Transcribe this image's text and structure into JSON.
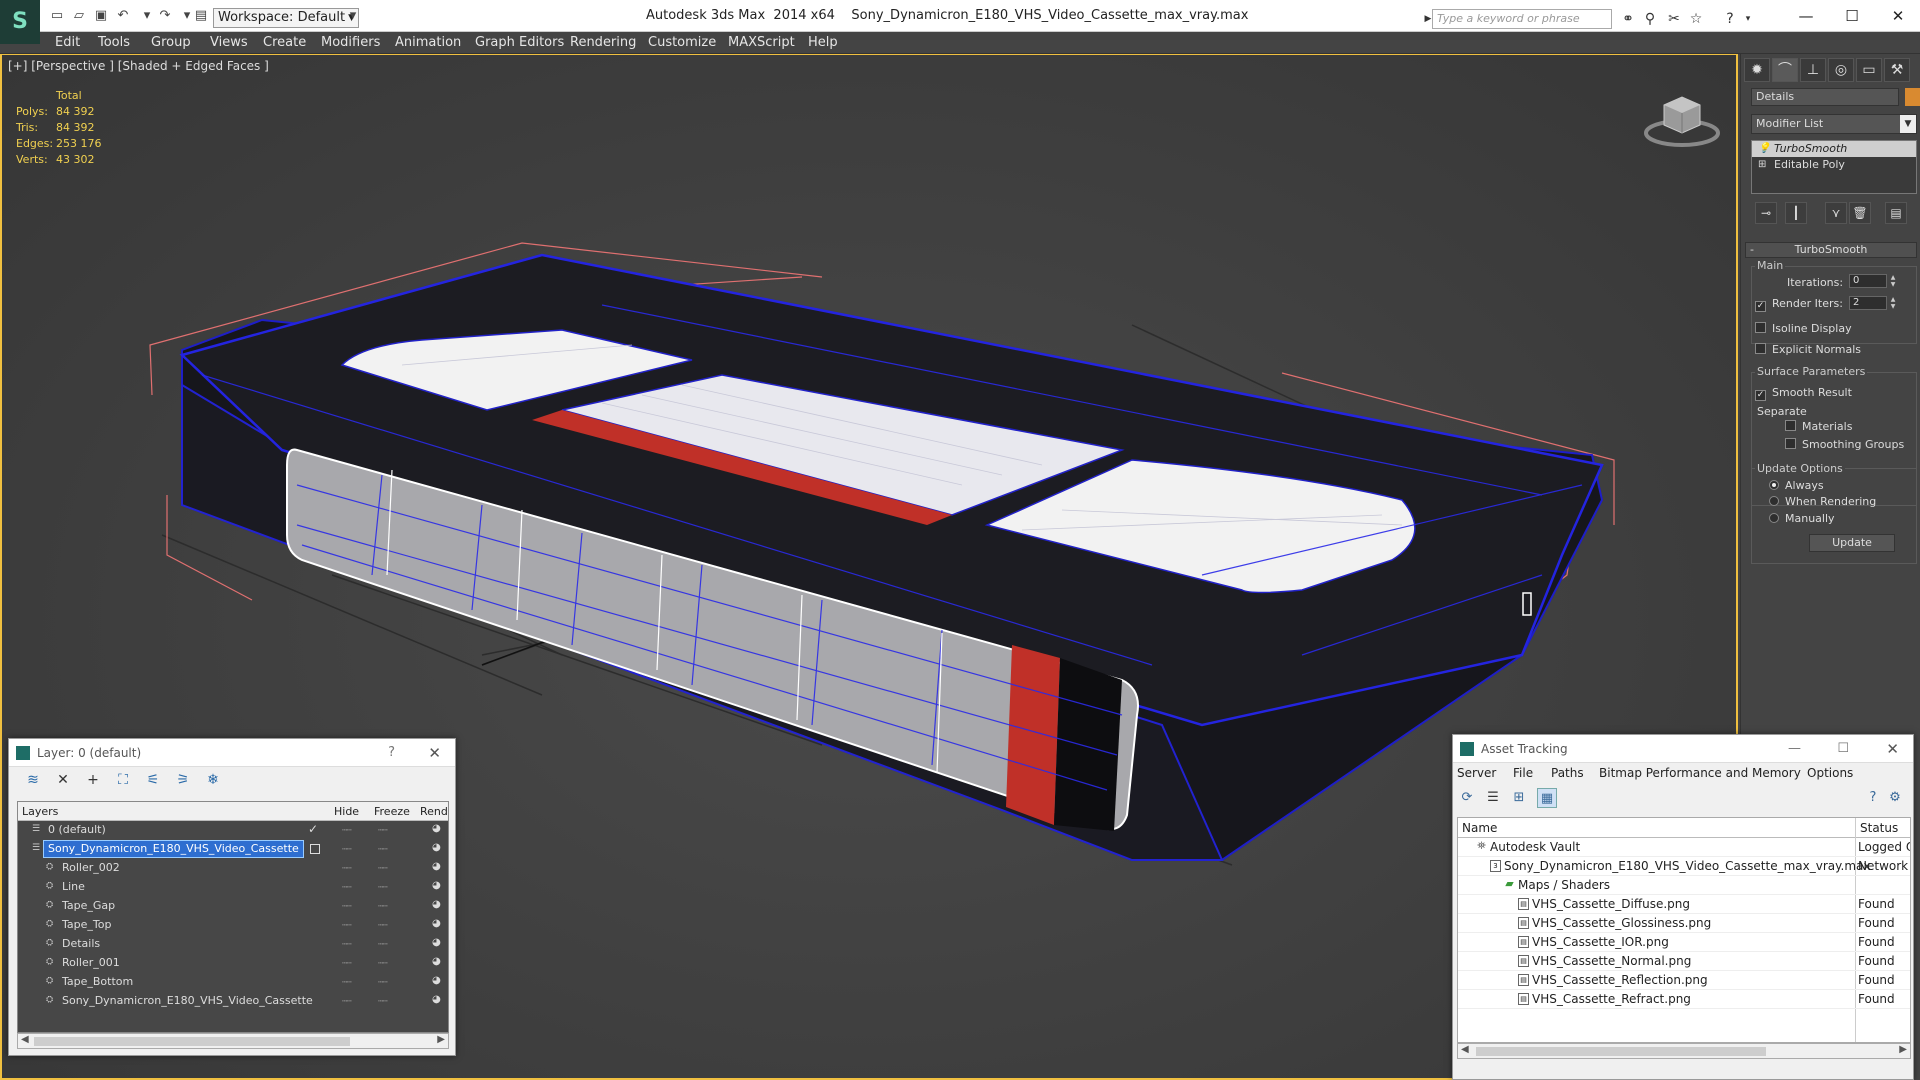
{
  "titlebar": {
    "logo_glyph": "S",
    "workspace": "Workspace: Default",
    "app_title": "Autodesk 3ds Max  2014 x64",
    "file_title": "Sony_Dynamicron_E180_VHS_Video_Cassette_max_vray.max",
    "search_placeholder": "Type a keyword or phrase",
    "window_controls": {
      "minimize": "—",
      "maximize": "☐",
      "close": "✕"
    }
  },
  "menu": [
    "Edit",
    "Tools",
    "Group",
    "Views",
    "Create",
    "Modifiers",
    "Animation",
    "Graph Editors",
    "Rendering",
    "Customize",
    "MAXScript",
    "Help"
  ],
  "viewport": {
    "label": "[+] [Perspective ] [Shaded + Edged Faces ]",
    "stats_header": "Total",
    "stats": [
      {
        "label": "Polys:",
        "value": "84 392"
      },
      {
        "label": "Tris:",
        "value": "84 392"
      },
      {
        "label": "Edges:",
        "value": "253 176"
      },
      {
        "label": "Verts:",
        "value": "43 302"
      }
    ]
  },
  "command_panel": {
    "object_name": "Details",
    "object_color": "#d98a30",
    "modifier_list": "Modifier List",
    "stack": [
      {
        "label": "TurboSmooth",
        "selected": true
      },
      {
        "label": "Editable Poly",
        "selected": false
      }
    ],
    "rollout_title": "TurboSmooth",
    "main_label": "Main",
    "iterations_label": "Iterations:",
    "iterations_value": "0",
    "render_iters_label": "Render Iters:",
    "render_iters_value": "2",
    "render_iters_checked": "✓",
    "isoline_label": "Isoline Display",
    "explicit_normals_label": "Explicit Normals",
    "surface_params_label": "Surface Parameters",
    "smooth_result_label": "Smooth Result",
    "smooth_result_checked": "✓",
    "separate_label": "Separate",
    "materials_label": "Materials",
    "smoothing_groups_label": "Smoothing Groups",
    "update_options_label": "Update Options",
    "always_label": "Always",
    "when_rendering_label": "When Rendering",
    "manually_label": "Manually",
    "update_button": "Update"
  },
  "layer_window": {
    "title": "Layer: 0 (default)",
    "help": "?",
    "close": "✕",
    "columns": {
      "layers": "Layers",
      "hide": "Hide",
      "freeze": "Freeze",
      "render": "Rende"
    },
    "rows": [
      {
        "name": "0 (default)",
        "indent": 0,
        "check": "✓"
      },
      {
        "name": "Sony_Dynamicron_E180_VHS_Video_Cassette",
        "indent": 0,
        "selected": true
      },
      {
        "name": "Roller_002",
        "indent": 1
      },
      {
        "name": "Line",
        "indent": 1
      },
      {
        "name": "Tape_Gap",
        "indent": 1
      },
      {
        "name": "Tape_Top",
        "indent": 1
      },
      {
        "name": "Details",
        "indent": 1
      },
      {
        "name": "Roller_001",
        "indent": 1
      },
      {
        "name": "Tape_Bottom",
        "indent": 1
      },
      {
        "name": "Sony_Dynamicron_E180_VHS_Video_Cassette",
        "indent": 1
      }
    ]
  },
  "asset_window": {
    "title": "Asset Tracking",
    "menu": [
      "Server",
      "File",
      "Paths",
      "Bitmap Performance and Memory",
      "Options"
    ],
    "columns": {
      "name": "Name",
      "status": "Status"
    },
    "rows": [
      {
        "name": "Autodesk Vault",
        "indent": 1,
        "status": "Logged O"
      },
      {
        "name": "Sony_Dynamicron_E180_VHS_Video_Cassette_max_vray.max",
        "indent": 2,
        "status": "Network P"
      },
      {
        "name": "Maps / Shaders",
        "indent": 3,
        "status": ""
      },
      {
        "name": "VHS_Cassette_Diffuse.png",
        "indent": 4,
        "status": "Found"
      },
      {
        "name": "VHS_Cassette_Glossiness.png",
        "indent": 4,
        "status": "Found"
      },
      {
        "name": "VHS_Cassette_IOR.png",
        "indent": 4,
        "status": "Found"
      },
      {
        "name": "VHS_Cassette_Normal.png",
        "indent": 4,
        "status": "Found"
      },
      {
        "name": "VHS_Cassette_Reflection.png",
        "indent": 4,
        "status": "Found"
      },
      {
        "name": "VHS_Cassette_Refract.png",
        "indent": 4,
        "status": "Found"
      }
    ]
  },
  "colors": {
    "viewport_border": "#f0c040",
    "wire_blue": "#2020d0",
    "bbox_pink": "#e07070",
    "cassette_body": "#1a1a1a",
    "label_red": "#c03028",
    "stats_yellow": "#f0d050"
  }
}
